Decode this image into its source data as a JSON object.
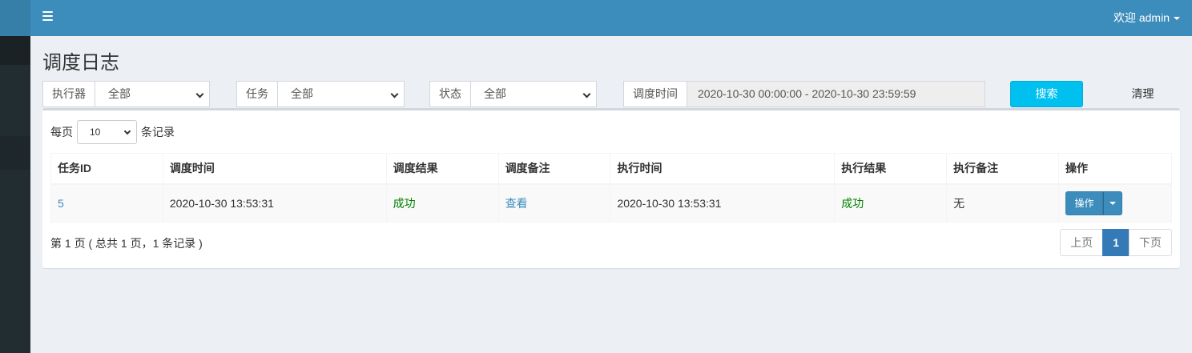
{
  "header": {
    "user_menu": "欢迎 admin"
  },
  "page": {
    "title": "调度日志"
  },
  "filters": {
    "executor": {
      "label": "执行器",
      "value": "全部"
    },
    "job": {
      "label": "任务",
      "value": "全部"
    },
    "status": {
      "label": "状态",
      "value": "全部"
    },
    "time": {
      "label": "调度时间",
      "value": "2020-10-30 00:00:00 - 2020-10-30 23:59:59"
    },
    "search_label": "搜索",
    "clear_label": "清理"
  },
  "table_length": {
    "prefix": "每页",
    "value": "10",
    "suffix": "条记录"
  },
  "table": {
    "columns": [
      "任务ID",
      "调度时间",
      "调度结果",
      "调度备注",
      "执行时间",
      "执行结果",
      "执行备注",
      "操作"
    ],
    "rows": [
      {
        "job_id": "5",
        "trigger_time": "2020-10-30 13:53:31",
        "trigger_result": "成功",
        "trigger_msg": "查看",
        "handle_time": "2020-10-30 13:53:31",
        "handle_result": "成功",
        "handle_msg": "无",
        "action": "操作"
      }
    ]
  },
  "footer": {
    "info": "第 1 页 ( 总共 1 页，1 条记录 )",
    "prev": "上页",
    "current": "1",
    "next": "下页"
  },
  "colors": {
    "header": "#3c8dbc",
    "sidebar": "#222d32",
    "search_button": "#00c0ef",
    "success": "#008000"
  }
}
